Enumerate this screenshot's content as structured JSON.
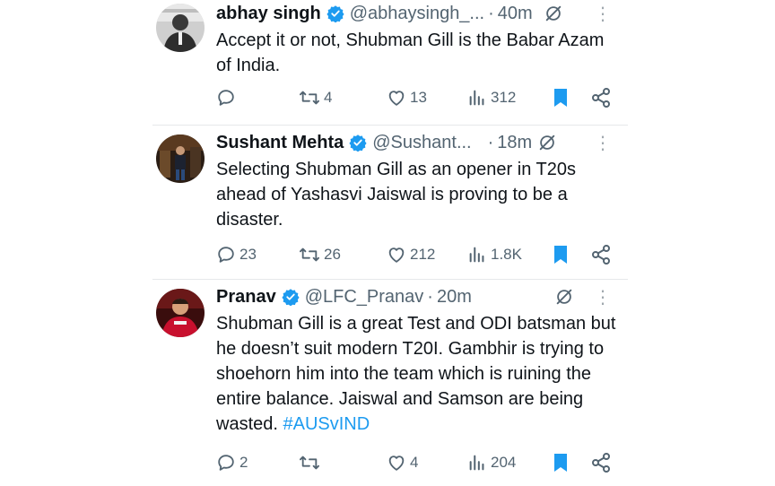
{
  "tweets": [
    {
      "name": "abhay singh",
      "handle": "@abhaysingh_...",
      "dot": "·",
      "time": "40m",
      "text": "Accept it or not, Shubman Gill is the Babar Azam of India.",
      "hashtag": "",
      "replies": "",
      "retweets": "4",
      "likes": "13",
      "views": "312"
    },
    {
      "name": "Sushant Mehta",
      "handle": "@Sushant...",
      "dot": "·",
      "time": "18m",
      "text": "Selecting Shubman Gill as an opener in T20s ahead of Yashasvi Jaiswal is proving to be a disaster.",
      "hashtag": "",
      "replies": "23",
      "retweets": "26",
      "likes": "212",
      "views": "1.8K"
    },
    {
      "name": "Pranav",
      "handle": "@LFC_Pranav",
      "dot": "·",
      "time": "20m",
      "text": "Shubman Gill is a great Test and ODI batsman but he doesn’t suit modern T20I. Gambhir is trying to shoehorn him into the team which is ruining the entire balance. Jaiswal and Samson are being wasted. ",
      "hashtag": "#AUSvIND",
      "replies": "2",
      "retweets": "",
      "likes": "4",
      "views": "204"
    }
  ],
  "colors": {
    "accent": "#1d9bf0",
    "bookmark": "#1d9bf0",
    "verified": "#1d9bf0",
    "muted": "#536471"
  },
  "icons": [
    "verified-badge-icon",
    "grok-icon",
    "more-icon",
    "reply-icon",
    "retweet-icon",
    "like-icon",
    "views-icon",
    "bookmark-icon",
    "share-icon"
  ]
}
